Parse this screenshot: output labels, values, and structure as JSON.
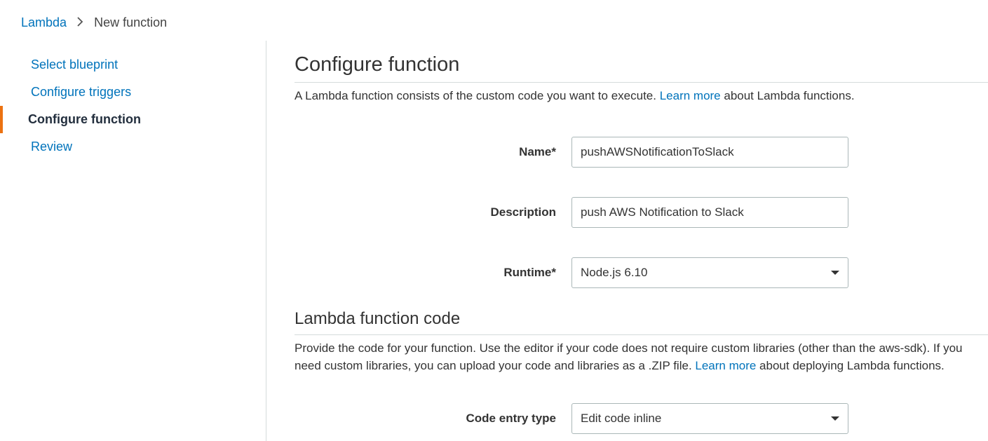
{
  "breadcrumb": {
    "root": "Lambda",
    "current": "New function"
  },
  "sidebar": {
    "items": [
      {
        "label": "Select blueprint"
      },
      {
        "label": "Configure triggers"
      },
      {
        "label": "Configure function"
      },
      {
        "label": "Review"
      }
    ],
    "active_index": 2
  },
  "section1": {
    "title": "Configure function",
    "desc_part1": "A Lambda function consists of the custom code you want to execute. ",
    "desc_link": "Learn more",
    "desc_part2": " about Lambda functions."
  },
  "form": {
    "name_label": "Name*",
    "name_value": "pushAWSNotificationToSlack",
    "description_label": "Description",
    "description_value": "push AWS Notification to Slack",
    "runtime_label": "Runtime*",
    "runtime_value": "Node.js 6.10"
  },
  "section2": {
    "title": "Lambda function code",
    "desc_part1": "Provide the code for your function. Use the editor if your code does not require custom libraries (other than the aws-sdk). If you need custom libraries, you can upload your code and libraries as a .ZIP file. ",
    "desc_link": "Learn more",
    "desc_part2": " about deploying Lambda functions."
  },
  "codeentry": {
    "label": "Code entry type",
    "value": "Edit code inline"
  }
}
